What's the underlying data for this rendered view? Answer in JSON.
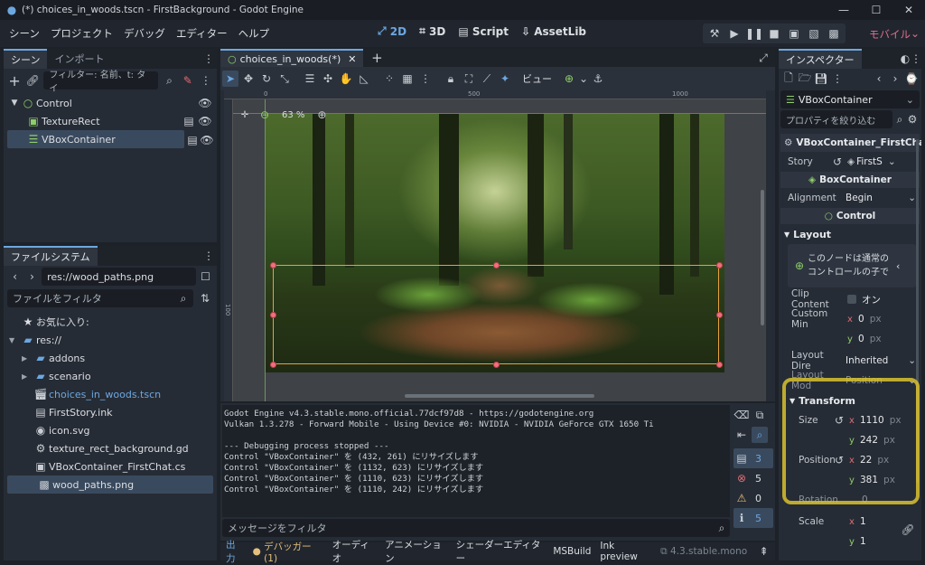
{
  "titlebar": {
    "title": "(*) choices_in_woods.tscn - FirstBackground - Godot Engine"
  },
  "menu": {
    "items": [
      "シーン",
      "プロジェクト",
      "デバッグ",
      "エディター",
      "ヘルプ"
    ],
    "workspaces": [
      {
        "label": "2D",
        "icon": "2d-icon"
      },
      {
        "label": "3D",
        "icon": "3d-icon"
      },
      {
        "label": "Script",
        "icon": "script-icon"
      },
      {
        "label": "AssetLib",
        "icon": "assetlib-icon"
      }
    ],
    "renderer": "モバイル"
  },
  "scene_dock": {
    "tabs": [
      "シーン",
      "インポート"
    ],
    "filter_placeholder": "フィルター: 名前、t: タイ",
    "nodes": [
      {
        "name": "Control",
        "level": 0
      },
      {
        "name": "TextureRect",
        "level": 1
      },
      {
        "name": "VBoxContainer",
        "level": 1,
        "selected": true
      }
    ]
  },
  "fs_dock": {
    "tab": "ファイルシステム",
    "path": "res://wood_paths.png",
    "filter_placeholder": "ファイルをフィルタ",
    "items": [
      {
        "name": "お気に入り:",
        "icon": "star-icon",
        "indent": 0
      },
      {
        "name": "res://",
        "icon": "folder-icon",
        "indent": 0
      },
      {
        "name": "addons",
        "icon": "folder-icon",
        "indent": 1
      },
      {
        "name": "scenario",
        "icon": "folder-icon",
        "indent": 1
      },
      {
        "name": "choices_in_woods.tscn",
        "icon": "scene-file-icon",
        "indent": 1,
        "highlight": true
      },
      {
        "name": "FirstStory.ink",
        "icon": "document-icon",
        "indent": 1
      },
      {
        "name": "icon.svg",
        "icon": "svg-file-icon",
        "indent": 1
      },
      {
        "name": "texture_rect_background.gd",
        "icon": "gear-icon",
        "indent": 1
      },
      {
        "name": "VBoxContainer_FirstChat.cs",
        "icon": "cs-file-icon",
        "indent": 1
      },
      {
        "name": "wood_paths.png",
        "icon": "image-file-icon",
        "indent": 1,
        "selected": true
      }
    ]
  },
  "editor": {
    "scene_tab": "choices_in_woods(*)",
    "zoom": "63 %",
    "view_label": "ビュー",
    "ruler_marks": [
      "0",
      "500",
      "1000"
    ],
    "ruler_v": [
      "100"
    ]
  },
  "output": {
    "lines": [
      "Godot Engine v4.3.stable.mono.official.77dcf97d8 - https://godotengine.org",
      "Vulkan 1.3.278 - Forward Mobile - Using Device #0: NVIDIA - NVIDIA GeForce GTX 1650 Ti",
      "",
      "--- Debugging process stopped ---",
      "Control \"VBoxContainer\" を (432, 261) にリサイズします",
      "Control \"VBoxContainer\" を (1132, 623) にリサイズします",
      "Control \"VBoxContainer\" を (1110, 623) にリサイズします",
      "Control \"VBoxContainer\" を (1110, 242) にリサイズします"
    ],
    "filter_placeholder": "メッセージをフィルタ",
    "counts": {
      "log": "3",
      "errors": "5",
      "warnings": "0",
      "info": "5"
    }
  },
  "bottom_tabs": [
    "出力",
    "デバッガー (1)",
    "オーディオ",
    "アニメーション",
    "シェーダーエディター",
    "MSBuild",
    "Ink preview"
  ],
  "version": "4.3.stable.mono",
  "inspector": {
    "tab": "インスペクター",
    "node_type": "VBoxContainer",
    "filter_placeholder": "プロパティを絞り込む",
    "node_name": "VBoxContainer_FirstChat",
    "story_label": "Story",
    "story_value": "FirstS",
    "class_box": "BoxContainer",
    "alignment_label": "Alignment",
    "alignment_value": "Begin",
    "class_control": "Control",
    "layout_section": "Layout",
    "notice": "このノードは通常のコントロールの子です。",
    "clip_label": "Clip Content",
    "clip_value": "オン",
    "custom_min_label": "Custom Min",
    "custom_min": {
      "x": "0",
      "y": "0",
      "unit": "px"
    },
    "layout_dir_label": "Layout Dire",
    "layout_dir_value": "Inherited",
    "layout_mode_label": "Layout Mod",
    "layout_mode_value": "Position",
    "transform_section": "Transform",
    "size_label": "Size",
    "size": {
      "x": "1110",
      "y": "242",
      "unit": "px"
    },
    "position_label": "Position",
    "position": {
      "x": "22",
      "y": "381",
      "unit": "px"
    },
    "rotation_label": "Rotation",
    "rotation_value": "0",
    "scale_label": "Scale",
    "scale": {
      "x": "1",
      "y": "1"
    }
  },
  "colors": {
    "accent": "#6da7e0",
    "highlight_box": "#d9c22e",
    "selection": "#3a4a5e",
    "renderer": "#e26f8f"
  }
}
